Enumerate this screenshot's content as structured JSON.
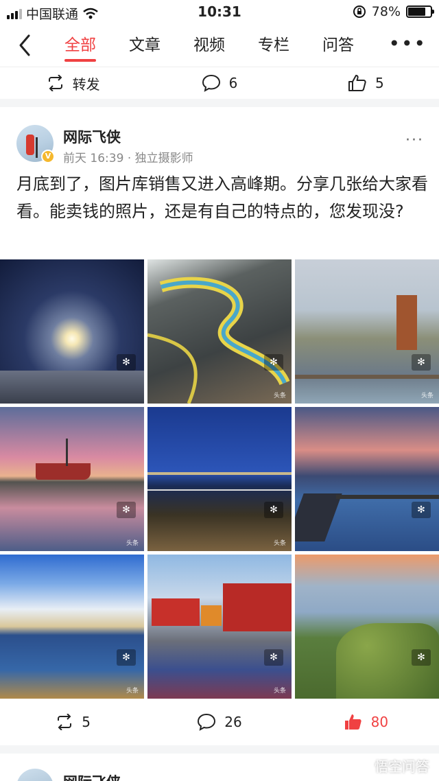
{
  "status_bar": {
    "carrier": "中国联通",
    "time": "10:31",
    "battery": "78%",
    "battery_level": 0.78
  },
  "nav": {
    "tabs": [
      "全部",
      "文章",
      "视频",
      "专栏",
      "问答",
      "/"
    ],
    "active_index": 0,
    "accent": "#f04142"
  },
  "prev_post": {
    "actions": {
      "repost_label": "转发",
      "comments": "6",
      "likes": "5"
    }
  },
  "post": {
    "author": "网际飞侠",
    "time": "前天 16:39",
    "separator": "·",
    "title": "独立摄影师",
    "text": "月底到了，图片库销售又进入高峰期。分享几张给大家看看。能卖钱的照片，还是有自己的特点的，您发现没?",
    "watermark": "头条",
    "actions": {
      "reposts": "5",
      "comments": "26",
      "likes": "80"
    },
    "like_color": "#f04142"
  },
  "next_post": {
    "author": "网际飞侠"
  },
  "brand_watermark": "悟空问答"
}
